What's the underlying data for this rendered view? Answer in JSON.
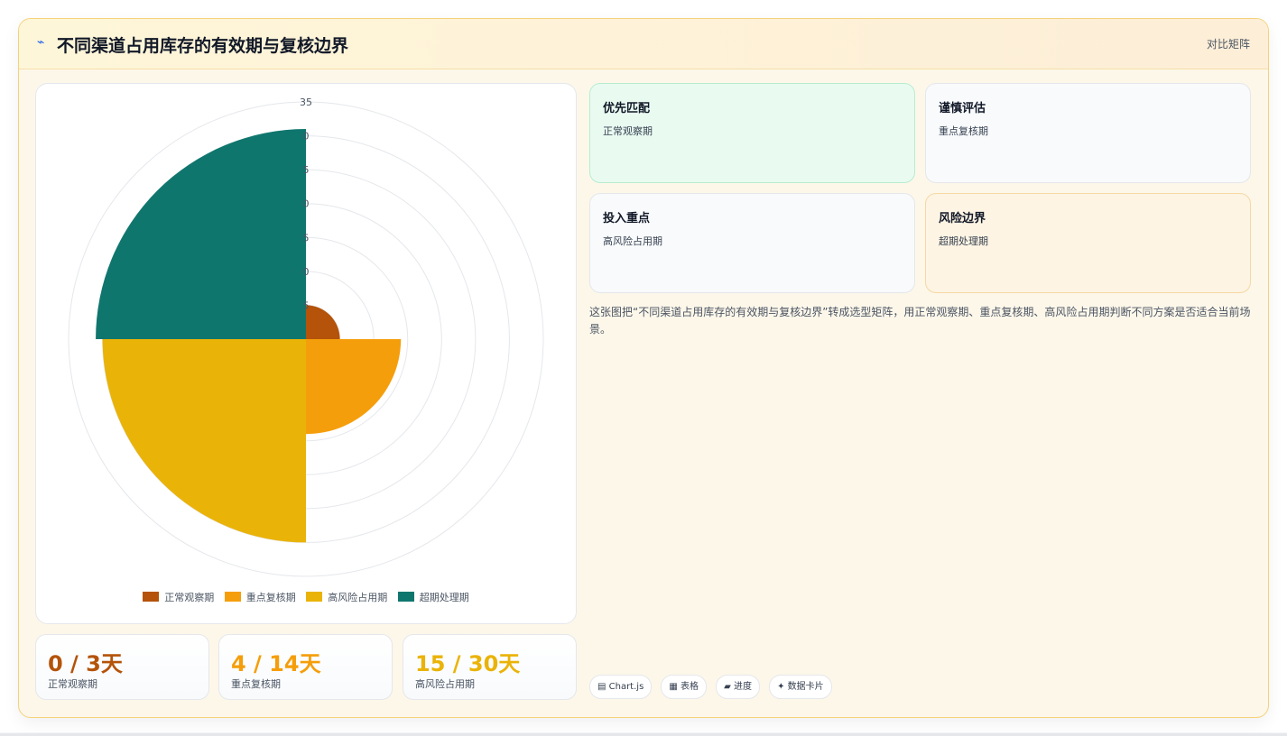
{
  "header": {
    "icon": "⌁",
    "title": "不同渠道占用库存的有效期与复核边界",
    "tag": "对比矩阵"
  },
  "colors": {
    "accent": "#f5d27a",
    "series": [
      "#b45309",
      "#f59e0b",
      "#eab308",
      "#0f766e"
    ]
  },
  "chart_data": {
    "type": "polarArea",
    "categories": [
      "正常观察期",
      "重点复核期",
      "高风险占用期",
      "超期处理期"
    ],
    "values": [
      5,
      14,
      30,
      31
    ],
    "r_ticks": [
      0,
      5,
      10,
      15,
      20,
      25,
      30,
      35
    ],
    "r_tick_labels": [
      "",
      "5",
      "0",
      "5",
      "0",
      "5",
      "0",
      "35"
    ],
    "rlim": [
      0,
      35
    ],
    "legend_position": "bottom",
    "grid": true
  },
  "stats": [
    {
      "value": "0 / 3天",
      "label": "正常观察期",
      "color": "#b45309"
    },
    {
      "value": "4 / 14天",
      "label": "重点复核期",
      "color": "#f59e0b"
    },
    {
      "value": "15 / 30天",
      "label": "高风险占用期",
      "color": "#eab308"
    }
  ],
  "matrix": [
    {
      "title": "优先匹配",
      "sub": "正常观察期",
      "bg": "#e9fbf1",
      "border": "#b7ecd0"
    },
    {
      "title": "谨慎评估",
      "sub": "重点复核期",
      "bg": "#f8fafc",
      "border": "#e5e7eb"
    },
    {
      "title": "投入重点",
      "sub": "高风险占用期",
      "bg": "#f8fafc",
      "border": "#e5e7eb"
    },
    {
      "title": "风险边界",
      "sub": "超期处理期",
      "bg": "#fdf4e3",
      "border": "#f5d8a2"
    }
  ],
  "description": "这张图把“不同渠道占用库存的有效期与复核边界”转成选型矩阵，用正常观察期、重点复核期、高风险占用期判断不同方案是否适合当前场景。",
  "chips": [
    "▤ Chart.js",
    "▦ 表格",
    "▰ 进度",
    "✦ 数据卡片"
  ]
}
